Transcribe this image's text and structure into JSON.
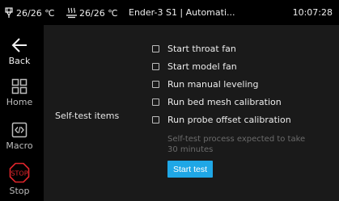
{
  "status_bar": {
    "nozzle_temp": "26/26 ℃",
    "bed_temp": "26/26 ℃",
    "title": "Ender-3 S1 | Automati...",
    "clock": "10:07:28"
  },
  "sidebar": {
    "items": [
      {
        "label": "Back",
        "icon": "arrow-left-icon"
      },
      {
        "label": "Home",
        "icon": "grid-icon"
      },
      {
        "label": "Macro",
        "icon": "code-icon"
      },
      {
        "label": "Stop",
        "icon": "stop-icon",
        "icon_text": "STOP"
      }
    ]
  },
  "main": {
    "section_label": "Self-test items",
    "checks": [
      {
        "label": "Start throat fan",
        "checked": false
      },
      {
        "label": "Start model fan",
        "checked": false
      },
      {
        "label": "Run manual leveling",
        "checked": false
      },
      {
        "label": "Run bed mesh calibration",
        "checked": false
      },
      {
        "label": "Run probe offset calibration",
        "checked": false
      }
    ],
    "note": "Self-test process expected to take 30 minutes",
    "start_button": "Start test"
  },
  "colors": {
    "accent": "#1fa7e6",
    "stop": "#e0252b",
    "panel": "#1a1a1a"
  }
}
